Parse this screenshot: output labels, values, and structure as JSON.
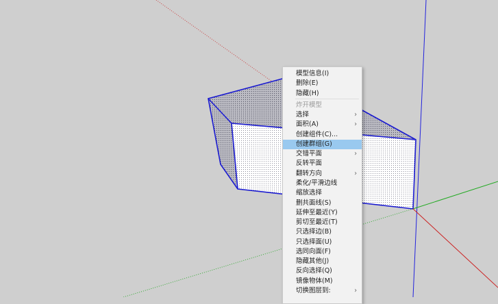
{
  "colors": {
    "axis_red": "#cc2222",
    "axis_green": "#22aa22",
    "axis_blue": "#2222dd",
    "selection": "#1a1ad0",
    "highlight": "#99c9ef"
  },
  "menu": {
    "items": [
      {
        "label": "模型信息(I)",
        "submenu": false
      },
      {
        "label": "删除(E)",
        "submenu": false
      },
      {
        "label": "隐藏(H)",
        "submenu": false
      },
      {
        "label": "炸开模型",
        "submenu": false,
        "disabled": true
      },
      {
        "label": "选择",
        "submenu": true
      },
      {
        "label": "面积(A)",
        "submenu": true
      },
      {
        "label": "创建组件(C)...",
        "submenu": false
      },
      {
        "label": "创建群组(G)",
        "submenu": false,
        "highlighted": true
      },
      {
        "label": "交错平面",
        "submenu": true
      },
      {
        "label": "反转平面",
        "submenu": false
      },
      {
        "label": "翻转方向",
        "submenu": true
      },
      {
        "label": "柔化/平滑边线",
        "submenu": false
      },
      {
        "label": "缩放选择",
        "submenu": false
      },
      {
        "label": "删共面线(S)",
        "submenu": false
      },
      {
        "label": "延伸至最近(Y)",
        "submenu": false
      },
      {
        "label": "剪切至最近(T)",
        "submenu": false
      },
      {
        "label": "只选择边(B)",
        "submenu": false
      },
      {
        "label": "只选择面(U)",
        "submenu": false
      },
      {
        "label": "选同向面(F)",
        "submenu": false
      },
      {
        "label": "隐藏其他(J)",
        "submenu": false
      },
      {
        "label": "反向选择(Q)",
        "submenu": false
      },
      {
        "label": "镜像物体(M)",
        "submenu": false
      },
      {
        "label": "切换图层到:",
        "submenu": true
      }
    ],
    "arrow": "›"
  }
}
